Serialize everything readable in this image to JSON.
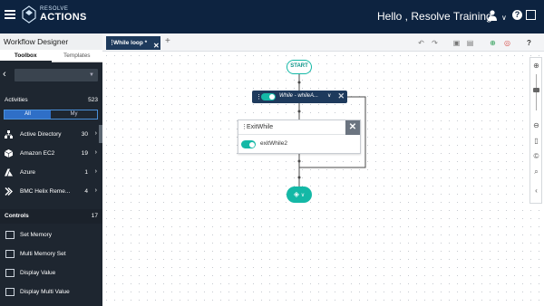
{
  "header": {
    "logo_top": "RESOLVE",
    "logo_main": "ACTIONS",
    "greeting": "Hello , Resolve Training",
    "help": "?",
    "chevron": "∨"
  },
  "left_panel": {
    "title": "Workflow Designer",
    "tabs": [
      {
        "label": "Toolbox",
        "active": true
      },
      {
        "label": "Templates",
        "active": false
      }
    ],
    "search_placeholder": "",
    "activities": {
      "label": "Activities",
      "count": "523",
      "filter_all": "All",
      "filter_my": "My",
      "items": [
        {
          "label": "Active Directory",
          "count": "30",
          "icon": "sitemap-icon"
        },
        {
          "label": "Amazon EC2",
          "count": "19",
          "icon": "cube-icon"
        },
        {
          "label": "Azure",
          "count": "1",
          "icon": "azure-icon"
        },
        {
          "label": "BMC Helix Reme...",
          "count": "4",
          "icon": "bmc-icon"
        }
      ]
    },
    "controls": {
      "label": "Controls",
      "count": "17",
      "items": [
        {
          "label": "Set Memory"
        },
        {
          "label": "Multi Memory Set"
        },
        {
          "label": "Display Value"
        },
        {
          "label": "Display Multi Value"
        }
      ]
    }
  },
  "canvas": {
    "tab_label": "While loop *",
    "start_label": "START",
    "while_label": "While - whileA...",
    "exit_title": "ExitWhile",
    "exit_item": "exitWhile2"
  },
  "colors": {
    "navy": "#0d2340",
    "panel": "#1e2630",
    "teal": "#14b8a6",
    "tab": "#1e3a5c"
  }
}
